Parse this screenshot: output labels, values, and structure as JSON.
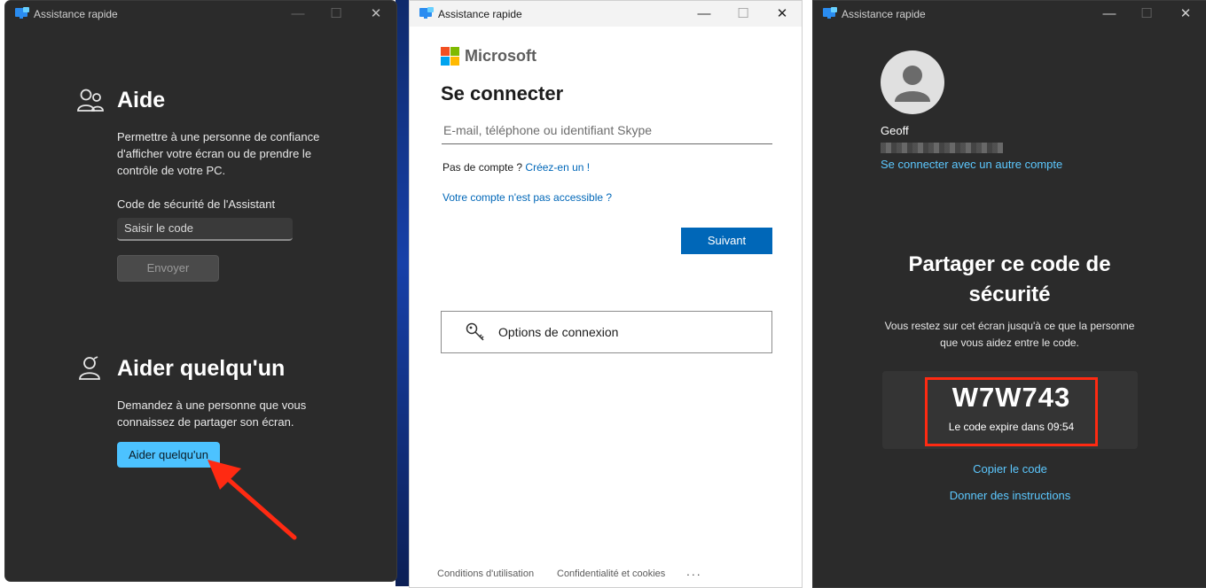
{
  "colors": {
    "dark_bg": "#2b2b2b",
    "accent": "#4cc2ff",
    "ms_blue": "#0067b8",
    "highlight_red": "#ff2a12"
  },
  "window1": {
    "title": "Assistance rapide",
    "help_section": {
      "heading": "Aide",
      "description": "Permettre à une personne de confiance d'afficher votre écran ou de prendre le contrôle de votre PC.",
      "code_label": "Code de sécurité de l'Assistant",
      "code_placeholder": "Saisir le code",
      "submit_label": "Envoyer"
    },
    "assist_section": {
      "heading": "Aider quelqu'un",
      "description": "Demandez à une personne que vous connaissez de partager son écran.",
      "button_label": "Aider quelqu'un"
    }
  },
  "window2": {
    "title": "Assistance rapide",
    "brand": "Microsoft",
    "heading": "Se connecter",
    "email_placeholder": "E-mail, téléphone ou identifiant Skype",
    "no_account_text": "Pas de compte ?",
    "create_link": "Créez-en un !",
    "inaccessible_link": "Votre compte n'est pas accessible ?",
    "next_button": "Suivant",
    "signin_options": "Options de connexion",
    "footer": {
      "terms": "Conditions d'utilisation",
      "privacy": "Confidentialité et cookies",
      "more": "..."
    }
  },
  "window3": {
    "title": "Assistance rapide",
    "user_name": "Geoff",
    "switch_account_link": "Se connecter avec un autre compte",
    "heading": "Partager ce code de sécurité",
    "description": "Vous restez sur cet écran jusqu'à ce que la personne que vous aidez entre le code.",
    "security_code": "W7W743",
    "expiry_text": "Le code expire dans 09:54",
    "copy_link": "Copier le code",
    "instructions_link": "Donner des instructions"
  }
}
